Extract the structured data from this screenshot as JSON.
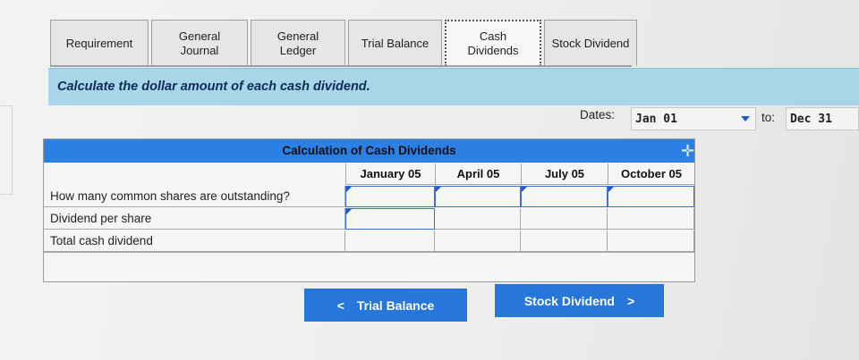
{
  "tabs": [
    {
      "label": "Requirement"
    },
    {
      "label": "General\nJournal"
    },
    {
      "label": "General\nLedger"
    },
    {
      "label": "Trial Balance"
    },
    {
      "label": "Cash\nDividends"
    },
    {
      "label": "Stock Dividend"
    }
  ],
  "banner": {
    "text": "Calculate the dollar amount of each cash dividend."
  },
  "dates": {
    "label": "Dates:",
    "from": "Jan 01",
    "to_label": "to:",
    "to": "Dec 31"
  },
  "table": {
    "title": "Calculation of Cash Dividends",
    "columns": [
      "January 05",
      "April 05",
      "July 05",
      "October 05"
    ],
    "rows": [
      {
        "label": "How many common shares are outstanding?"
      },
      {
        "label": "Dividend per share"
      },
      {
        "label": "Total cash dividend"
      }
    ]
  },
  "nav": {
    "prev_label": "Trial Balance",
    "next_label": "Stock Dividend"
  },
  "colors": {
    "accent": "#2677d9",
    "banner": "#a9d5e8",
    "title_bar": "#2c7fe3"
  }
}
